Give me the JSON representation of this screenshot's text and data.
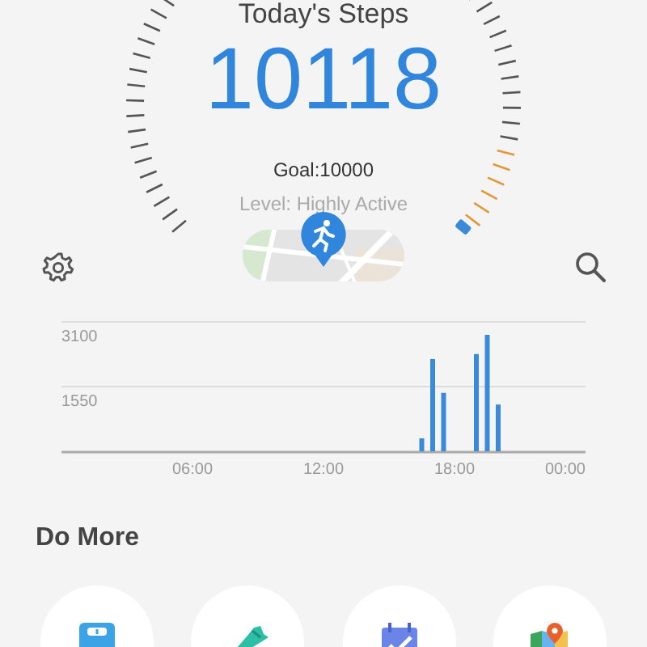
{
  "header": {
    "title": "Today's Steps",
    "steps": "10118",
    "goal": "Goal:10000",
    "level_text": "Level: Highly Active"
  },
  "chart": {
    "chart_data": {
      "type": "bar",
      "x": [
        16.5,
        17,
        17.5,
        19,
        19.5,
        20
      ],
      "series": [
        {
          "color": "#3b8ad9",
          "values": [
            310,
            2210,
            1400,
            2330,
            2790,
            1120
          ]
        }
      ],
      "xlim": [
        0,
        24
      ],
      "ylim": [
        0,
        3100
      ],
      "xticks": [
        {
          "value": 6,
          "label": "06:00"
        },
        {
          "value": 12,
          "label": "12:00"
        },
        {
          "value": 18,
          "label": "18:00"
        },
        {
          "value": 24,
          "label": "00:00"
        }
      ],
      "yticks": [
        {
          "value": 1550,
          "label": "1550"
        },
        {
          "value": 3100,
          "label": "3100"
        }
      ]
    }
  },
  "do_more": {
    "title": "Do More",
    "items": [
      {
        "kind": "scale"
      },
      {
        "kind": "shoe"
      },
      {
        "kind": "calendar"
      },
      {
        "kind": "map"
      }
    ]
  }
}
